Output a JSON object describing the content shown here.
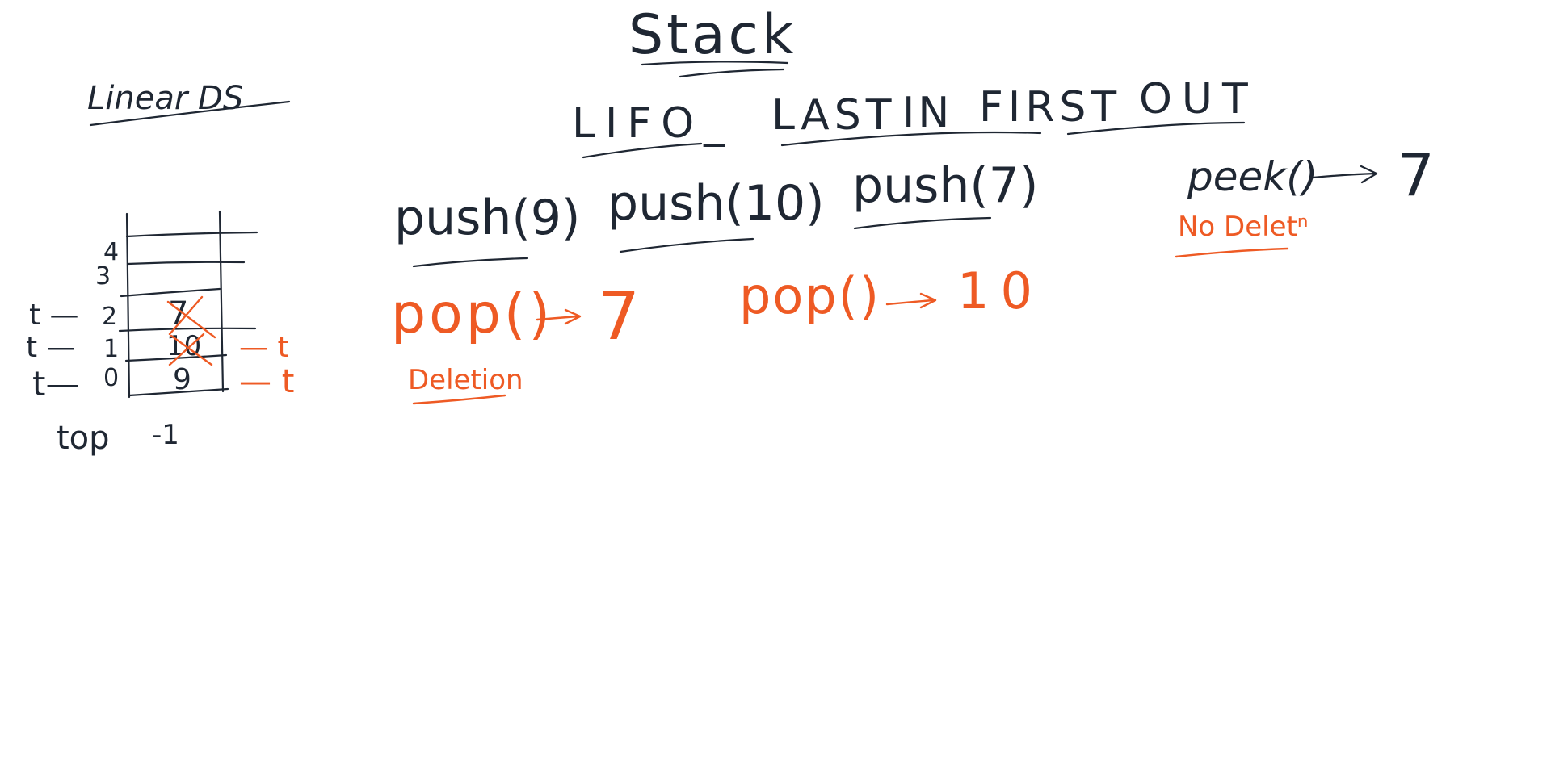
{
  "title": "Stack",
  "subtitle_left": "Linear DS",
  "lifo": {
    "abbr": "LIFO_",
    "w1": "LAST",
    "w2": "IN",
    "w3": "FIRST",
    "w4": "OUT"
  },
  "ops": {
    "push1": "push(9)",
    "push2": "push(10)",
    "push3": "push(7)",
    "peek": "peek()",
    "peek_result": "7",
    "peek_note": "No Deletⁿ",
    "pop1": "pop()",
    "pop1_result": "7",
    "pop2": "pop()",
    "pop2_result": "10",
    "deletion_note": "Deletion"
  },
  "stack": {
    "cells": [
      {
        "index": "4",
        "value": ""
      },
      {
        "index": "3",
        "value": ""
      },
      {
        "index": "2",
        "value": "7",
        "pointer_left": "t —"
      },
      {
        "index": "1",
        "value": "10",
        "pointer_left": "t —"
      },
      {
        "index": "0",
        "value": "9",
        "pointer_left": "t—"
      }
    ],
    "pointer_right_1": "— t",
    "pointer_right_0": "— t",
    "top_label": "top",
    "top_value": "-1"
  },
  "colors": {
    "ink": "#1f2733",
    "accent": "#ee5a24",
    "background": "#ffffff"
  }
}
